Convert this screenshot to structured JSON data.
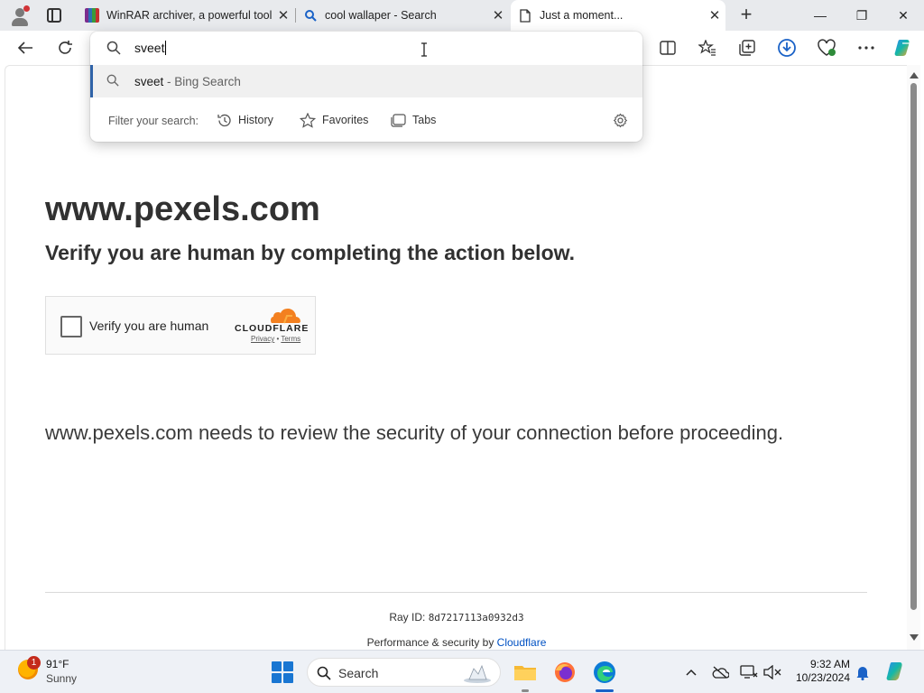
{
  "tabs": [
    {
      "title": "WinRAR archiver, a powerful tool",
      "close": "✕"
    },
    {
      "title": "cool wallaper - Search",
      "close": "✕"
    },
    {
      "title": "Just a moment...",
      "close": "✕"
    }
  ],
  "new_tab": "+",
  "window_controls": {
    "minimize": "—",
    "restore": "❐",
    "close": "✕"
  },
  "address_bar": {
    "value": "sveet"
  },
  "suggestion": {
    "query": "sveet",
    "suffix": " - Bing Search"
  },
  "filter": {
    "label": "Filter your search:",
    "chips": [
      "History",
      "Favorites",
      "Tabs"
    ]
  },
  "page": {
    "site": "www.pexels.com",
    "subtitle": "Verify you are human by completing the action below.",
    "checkbox_label": "Verify you are human",
    "cloudflare_word": "CLOUDFLARE",
    "privacy": "Privacy",
    "sep": " • ",
    "terms": "Terms",
    "review": "www.pexels.com needs to review the security of your connection before proceeding.",
    "ray_label": "Ray ID: ",
    "ray_id": "8d7217113a0932d3",
    "perf_prefix": "Performance & security by ",
    "perf_link": "Cloudflare"
  },
  "taskbar": {
    "weather_temp": "91°F",
    "weather_desc": "Sunny",
    "weather_badge": "1",
    "search": "Search",
    "time": "9:32 AM",
    "date": "10/23/2024"
  },
  "colors": {
    "accent": "#0051c3",
    "tab_strip": "#e8eaed",
    "windows_blue": "#1976d2",
    "cloudflare_orange": "#f38020"
  }
}
